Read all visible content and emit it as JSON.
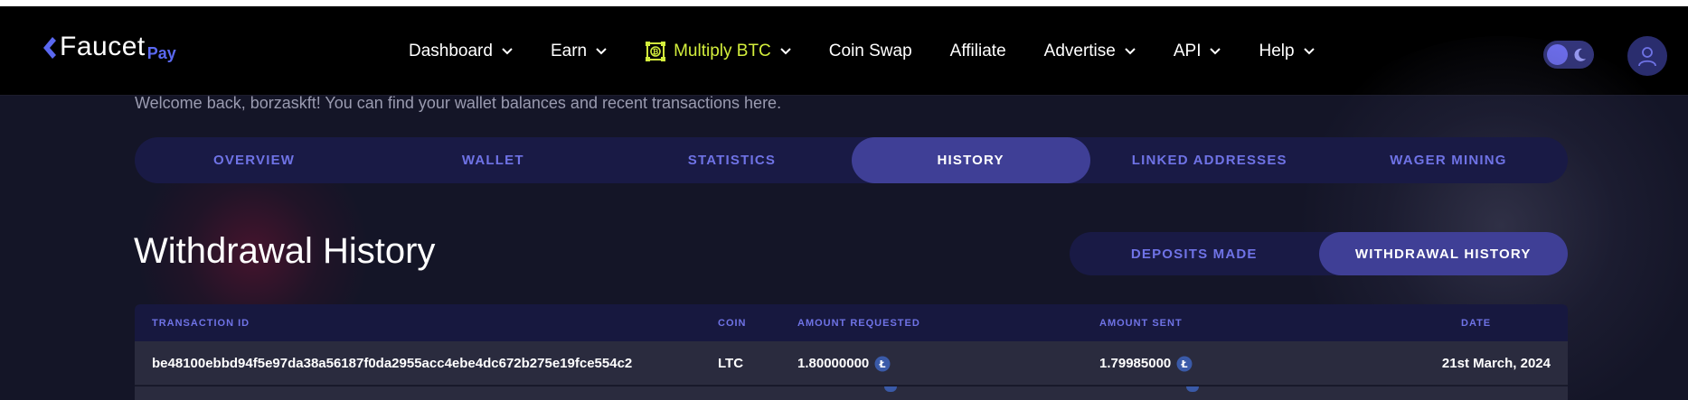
{
  "brand": {
    "name_main": "Faucet",
    "name_sub": "Pay",
    "accent": "#5a68f0"
  },
  "nav": {
    "items": [
      {
        "label": "Dashboard",
        "dropdown": true
      },
      {
        "label": "Earn",
        "dropdown": true
      },
      {
        "label": "Multiply BTC",
        "dropdown": true,
        "icon": "bitcoin-box-icon",
        "color": "#d3ee3c"
      },
      {
        "label": "Coin Swap",
        "dropdown": false
      },
      {
        "label": "Affiliate",
        "dropdown": false
      },
      {
        "label": "Advertise",
        "dropdown": true
      },
      {
        "label": "API",
        "dropdown": true
      },
      {
        "label": "Help",
        "dropdown": true
      }
    ]
  },
  "header_controls": {
    "theme_toggle_icon": "moon-icon",
    "avatar_icon": "user-icon"
  },
  "welcome_text": "Welcome back, borzaskft! You can find your wallet balances and recent transactions here.",
  "tabs": [
    {
      "label": "OVERVIEW",
      "active": false
    },
    {
      "label": "WALLET",
      "active": false
    },
    {
      "label": "STATISTICS",
      "active": false
    },
    {
      "label": "HISTORY",
      "active": true
    },
    {
      "label": "LINKED ADDRESSES",
      "active": false
    },
    {
      "label": "WAGER MINING",
      "active": false
    }
  ],
  "section_title": "Withdrawal History",
  "subtabs": [
    {
      "label": "DEPOSITS MADE",
      "active": false
    },
    {
      "label": "WITHDRAWAL HISTORY",
      "active": true
    }
  ],
  "table": {
    "columns": [
      "TRANSACTION ID",
      "COIN",
      "AMOUNT REQUESTED",
      "AMOUNT SENT",
      "DATE"
    ],
    "rows": [
      {
        "transaction_id": "be48100ebbd94f5e97da38a56187f0da2955acc4ebe4dc672b275e19fce554c2",
        "coin": "LTC",
        "amount_requested": "1.80000000",
        "amount_sent": "1.79985000",
        "date": "21st March, 2024",
        "coin_icon": "litecoin-icon"
      }
    ]
  },
  "colors": {
    "page_bg": "#141527",
    "navbar_bg": "#000000",
    "tab_bg": "#191a45",
    "tab_active_bg": "#3f3f96",
    "tab_text": "#6f73e6",
    "row_bg": "#2a2b3e"
  }
}
